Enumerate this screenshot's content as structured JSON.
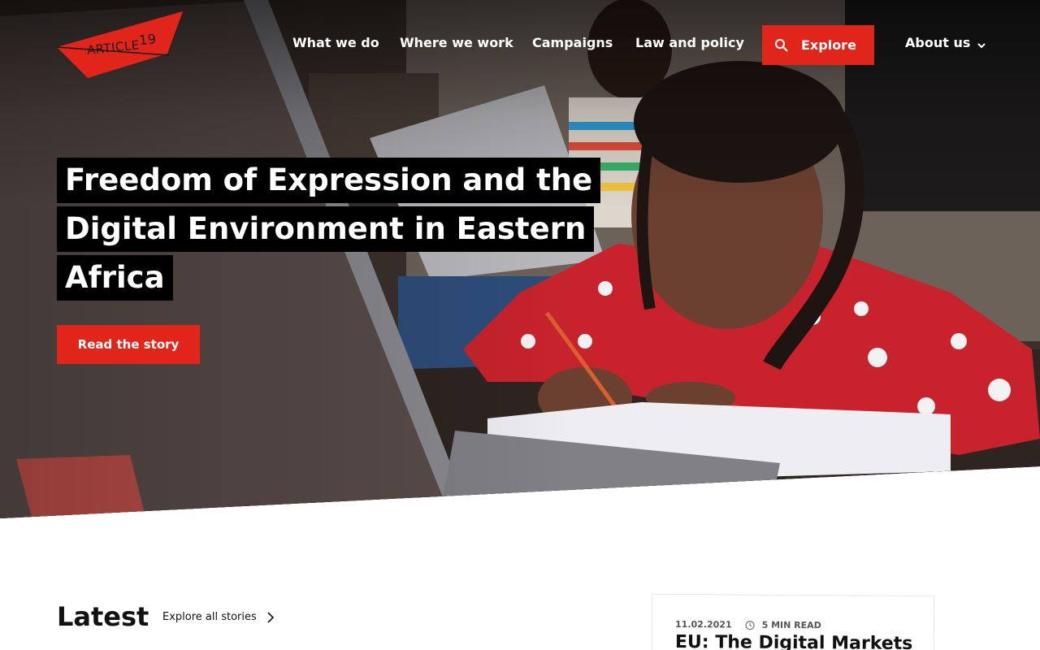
{
  "header": {
    "logo_text": "ARTICLE",
    "logo_number": "19",
    "nav": [
      {
        "label": "What we do"
      },
      {
        "label": "Where we work"
      },
      {
        "label": "Campaigns"
      },
      {
        "label": "Law and policy"
      }
    ],
    "explore_label": "Explore",
    "about_label": "About us",
    "brand_color": "#e1251b"
  },
  "hero": {
    "headline_lines": [
      "Freedom of Expression and the",
      "Digital Environment in Eastern",
      "Africa"
    ],
    "cta_label": "Read the story"
  },
  "latest": {
    "title": "Latest",
    "explore_all_label": "Explore all stories",
    "card": {
      "date": "11.02.2021",
      "read_time": "5 MIN READ",
      "title": "EU: The Digital Markets"
    }
  }
}
